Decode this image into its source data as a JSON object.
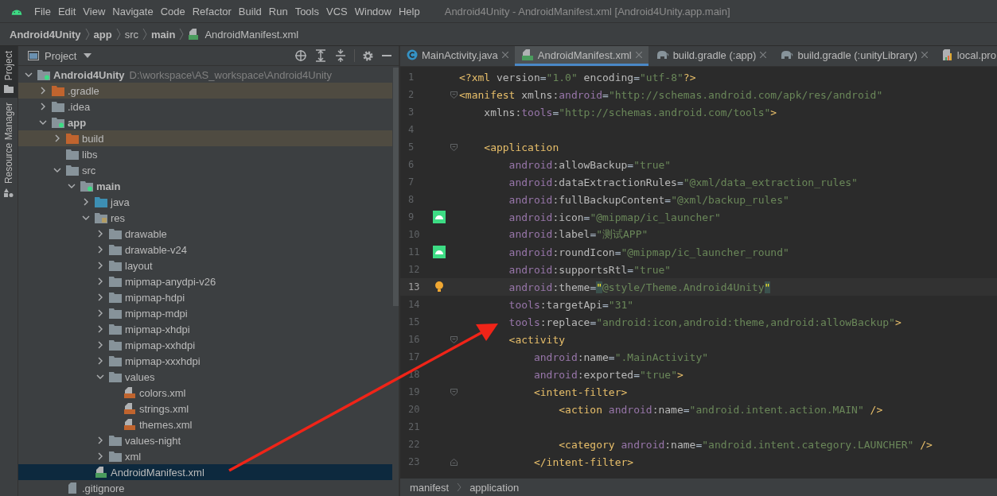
{
  "menu": {
    "items": [
      "File",
      "Edit",
      "View",
      "Navigate",
      "Code",
      "Refactor",
      "Build",
      "Run",
      "Tools",
      "VCS",
      "Window",
      "Help"
    ],
    "title": "Android4Unity - AndroidManifest.xml [Android4Unity.app.main]"
  },
  "navbar": [
    {
      "label": "Android4Unity",
      "kind": "module"
    },
    {
      "label": "app",
      "kind": "module"
    },
    {
      "label": "src",
      "kind": "folder"
    },
    {
      "label": "main",
      "kind": "module"
    },
    {
      "label": "AndroidManifest.xml",
      "kind": "manifest"
    }
  ],
  "side_tabs": [
    {
      "label": "Project",
      "selected": true,
      "kind": "project"
    },
    {
      "label": "Resource Manager",
      "selected": false,
      "kind": "resources"
    }
  ],
  "project_panel": {
    "title": "Project",
    "tree": [
      {
        "label": "Android4Unity",
        "detail": "D:\\workspace\\AS_workspace\\Android4Unity",
        "kind": "module",
        "bold": true,
        "excluded": false,
        "selected": false,
        "expanded": true,
        "children": [
          {
            "label": ".gradle",
            "kind": "excluded",
            "bold": false,
            "excluded": true,
            "selected": false,
            "expanded": false
          },
          {
            "label": ".idea",
            "kind": "folder",
            "bold": false,
            "excluded": false,
            "selected": false,
            "expanded": false
          },
          {
            "label": "app",
            "kind": "module",
            "bold": true,
            "excluded": false,
            "selected": false,
            "expanded": true,
            "children": [
              {
                "label": "build",
                "kind": "excluded",
                "bold": false,
                "excluded": true,
                "selected": false,
                "expanded": false
              },
              {
                "label": "libs",
                "kind": "folder",
                "bold": false,
                "excluded": false,
                "selected": false
              },
              {
                "label": "src",
                "kind": "folder",
                "bold": false,
                "excluded": false,
                "selected": false,
                "expanded": true,
                "children": [
                  {
                    "label": "main",
                    "kind": "module",
                    "bold": true,
                    "excluded": false,
                    "selected": false,
                    "expanded": true,
                    "children": [
                      {
                        "label": "java",
                        "kind": "source",
                        "bold": false,
                        "excluded": false,
                        "selected": false,
                        "expanded": false
                      },
                      {
                        "label": "res",
                        "kind": "res",
                        "bold": false,
                        "excluded": false,
                        "selected": false,
                        "expanded": true,
                        "children": [
                          {
                            "label": "drawable",
                            "kind": "folder",
                            "bold": false,
                            "excluded": false,
                            "selected": false,
                            "expanded": false
                          },
                          {
                            "label": "drawable-v24",
                            "kind": "folder",
                            "bold": false,
                            "excluded": false,
                            "selected": false,
                            "expanded": false
                          },
                          {
                            "label": "layout",
                            "kind": "folder",
                            "bold": false,
                            "excluded": false,
                            "selected": false,
                            "expanded": false
                          },
                          {
                            "label": "mipmap-anydpi-v26",
                            "kind": "folder",
                            "bold": false,
                            "excluded": false,
                            "selected": false,
                            "expanded": false
                          },
                          {
                            "label": "mipmap-hdpi",
                            "kind": "folder",
                            "bold": false,
                            "excluded": false,
                            "selected": false,
                            "expanded": false
                          },
                          {
                            "label": "mipmap-mdpi",
                            "kind": "folder",
                            "bold": false,
                            "excluded": false,
                            "selected": false,
                            "expanded": false
                          },
                          {
                            "label": "mipmap-xhdpi",
                            "kind": "folder",
                            "bold": false,
                            "excluded": false,
                            "selected": false,
                            "expanded": false
                          },
                          {
                            "label": "mipmap-xxhdpi",
                            "kind": "folder",
                            "bold": false,
                            "excluded": false,
                            "selected": false,
                            "expanded": false
                          },
                          {
                            "label": "mipmap-xxxhdpi",
                            "kind": "folder",
                            "bold": false,
                            "excluded": false,
                            "selected": false,
                            "expanded": false
                          },
                          {
                            "label": "values",
                            "kind": "folder",
                            "bold": false,
                            "excluded": false,
                            "selected": false,
                            "expanded": true,
                            "children": [
                              {
                                "label": "colors.xml",
                                "kind": "xml",
                                "bold": false,
                                "excluded": false,
                                "selected": false
                              },
                              {
                                "label": "strings.xml",
                                "kind": "xml",
                                "bold": false,
                                "excluded": false,
                                "selected": false
                              },
                              {
                                "label": "themes.xml",
                                "kind": "xml",
                                "bold": false,
                                "excluded": false,
                                "selected": false
                              }
                            ]
                          },
                          {
                            "label": "values-night",
                            "kind": "folder",
                            "bold": false,
                            "excluded": false,
                            "selected": false,
                            "expanded": false
                          },
                          {
                            "label": "xml",
                            "kind": "folder",
                            "bold": false,
                            "excluded": false,
                            "selected": false,
                            "expanded": false
                          }
                        ]
                      },
                      {
                        "label": "AndroidManifest.xml",
                        "kind": "manifest",
                        "bold": false,
                        "excluded": false,
                        "selected": true
                      }
                    ]
                  }
                ]
              },
              {
                "label": ".gitignore",
                "kind": "file",
                "bold": false,
                "excluded": false,
                "selected": false
              }
            ]
          }
        ]
      }
    ]
  },
  "editor": {
    "tabs": [
      {
        "label": "MainActivity.java",
        "kind": "class",
        "selected": false
      },
      {
        "label": "AndroidManifest.xml",
        "kind": "manifest",
        "selected": true
      },
      {
        "label": "build.gradle (:app)",
        "kind": "gradle",
        "selected": false
      },
      {
        "label": "build.gradle (:unityLibrary)",
        "kind": "gradle",
        "selected": false
      },
      {
        "label": "local.pro",
        "kind": "properties",
        "selected": false
      }
    ],
    "lines": [
      {
        "number": "1",
        "tokens": [
          {
            "kind": "tag",
            "text": "<?xml"
          },
          {
            "kind": "name",
            "text": " version"
          },
          {
            "kind": "plain",
            "text": "="
          },
          {
            "kind": "str",
            "text": "\"1.0\""
          },
          {
            "kind": "name",
            "text": " encoding"
          },
          {
            "kind": "plain",
            "text": "="
          },
          {
            "kind": "str",
            "text": "\"utf-8\""
          },
          {
            "kind": "tag",
            "text": "?>"
          }
        ]
      },
      {
        "number": "2",
        "fold_start": true,
        "tokens": [
          {
            "kind": "tag",
            "text": "<manifest"
          },
          {
            "kind": "name",
            "text": " xmlns:"
          },
          {
            "kind": "ns",
            "text": "android"
          },
          {
            "kind": "plain",
            "text": "="
          },
          {
            "kind": "str",
            "text": "\"http://schemas.android.com/apk/res/android\""
          }
        ]
      },
      {
        "number": "3",
        "tokens": [
          {
            "kind": "name",
            "text": "    xmlns:"
          },
          {
            "kind": "ns",
            "text": "tools"
          },
          {
            "kind": "plain",
            "text": "="
          },
          {
            "kind": "str",
            "text": "\"http://schemas.android.com/tools\""
          },
          {
            "kind": "tag",
            "text": ">"
          }
        ]
      },
      {
        "number": "4"
      },
      {
        "number": "5",
        "fold_start": true,
        "tokens": [
          {
            "kind": "tag",
            "text": "    <application"
          }
        ]
      },
      {
        "number": "6",
        "tokens": [
          {
            "kind": "ns",
            "text": "        android"
          },
          {
            "kind": "name",
            "text": ":allowBackup"
          },
          {
            "kind": "plain",
            "text": "="
          },
          {
            "kind": "str",
            "text": "\"true\""
          }
        ]
      },
      {
        "number": "7",
        "tokens": [
          {
            "kind": "ns",
            "text": "        android"
          },
          {
            "kind": "name",
            "text": ":dataExtractionRules"
          },
          {
            "kind": "plain",
            "text": "="
          },
          {
            "kind": "str",
            "text": "\"@xml/data_extraction_rules\""
          }
        ]
      },
      {
        "number": "8",
        "tokens": [
          {
            "kind": "ns",
            "text": "        android"
          },
          {
            "kind": "name",
            "text": ":fullBackupContent"
          },
          {
            "kind": "plain",
            "text": "="
          },
          {
            "kind": "str",
            "text": "\"@xml/backup_rules\""
          }
        ]
      },
      {
        "number": "9",
        "kind": "android",
        "tokens": [
          {
            "kind": "ns",
            "text": "        android"
          },
          {
            "kind": "name",
            "text": ":icon"
          },
          {
            "kind": "plain",
            "text": "="
          },
          {
            "kind": "str",
            "text": "\"@mipmap/ic_launcher\""
          }
        ]
      },
      {
        "number": "10",
        "tokens": [
          {
            "kind": "ns",
            "text": "        android"
          },
          {
            "kind": "name",
            "text": ":label"
          },
          {
            "kind": "plain",
            "text": "="
          },
          {
            "kind": "str",
            "text": "\"测试APP\""
          }
        ]
      },
      {
        "number": "11",
        "kind": "android",
        "tokens": [
          {
            "kind": "ns",
            "text": "        android"
          },
          {
            "kind": "name",
            "text": ":roundIcon"
          },
          {
            "kind": "plain",
            "text": "="
          },
          {
            "kind": "str",
            "text": "\"@mipmap/ic_launcher_round\""
          }
        ]
      },
      {
        "number": "12",
        "tokens": [
          {
            "kind": "ns",
            "text": "        android"
          },
          {
            "kind": "name",
            "text": ":supportsRtl"
          },
          {
            "kind": "plain",
            "text": "="
          },
          {
            "kind": "str",
            "text": "\"true\""
          }
        ]
      },
      {
        "number": "13",
        "current": true,
        "kind": "bulb",
        "tokens": [
          {
            "kind": "ns",
            "text": "        android"
          },
          {
            "kind": "name",
            "text": ":theme"
          },
          {
            "kind": "plain",
            "text": "="
          },
          {
            "kind": "match",
            "text": "\""
          },
          {
            "kind": "str",
            "text": "@style/Theme.Android4Unity"
          },
          {
            "kind": "match",
            "text": "\""
          }
        ]
      },
      {
        "number": "14",
        "tokens": [
          {
            "kind": "ns",
            "text": "        tools"
          },
          {
            "kind": "name",
            "text": ":targetApi"
          },
          {
            "kind": "plain",
            "text": "="
          },
          {
            "kind": "str",
            "text": "\"31\""
          }
        ]
      },
      {
        "number": "15",
        "tokens": [
          {
            "kind": "ns",
            "text": "        tools"
          },
          {
            "kind": "name",
            "text": ":replace"
          },
          {
            "kind": "plain",
            "text": "="
          },
          {
            "kind": "str",
            "text": "\"android:icon,android:theme,android:allowBackup\""
          },
          {
            "kind": "tag",
            "text": ">"
          }
        ]
      },
      {
        "number": "16",
        "fold_start": true,
        "tokens": [
          {
            "kind": "tag",
            "text": "        <activity"
          }
        ]
      },
      {
        "number": "17",
        "tokens": [
          {
            "kind": "ns",
            "text": "            android"
          },
          {
            "kind": "name",
            "text": ":name"
          },
          {
            "kind": "plain",
            "text": "="
          },
          {
            "kind": "str",
            "text": "\".MainActivity\""
          }
        ]
      },
      {
        "number": "18",
        "tokens": [
          {
            "kind": "ns",
            "text": "            android"
          },
          {
            "kind": "name",
            "text": ":exported"
          },
          {
            "kind": "plain",
            "text": "="
          },
          {
            "kind": "str",
            "text": "\"true\""
          },
          {
            "kind": "tag",
            "text": ">"
          }
        ]
      },
      {
        "number": "19",
        "fold_start": true,
        "tokens": [
          {
            "kind": "tag",
            "text": "            <intent-filter>"
          }
        ]
      },
      {
        "number": "20",
        "tokens": [
          {
            "kind": "tag",
            "text": "                <action"
          },
          {
            "kind": "ns",
            "text": " android"
          },
          {
            "kind": "name",
            "text": ":name"
          },
          {
            "kind": "plain",
            "text": "="
          },
          {
            "kind": "str",
            "text": "\"android.intent.action.MAIN\""
          },
          {
            "kind": "tag",
            "text": " />"
          }
        ]
      },
      {
        "number": "21"
      },
      {
        "number": "22",
        "tokens": [
          {
            "kind": "tag",
            "text": "                <category"
          },
          {
            "kind": "ns",
            "text": " android"
          },
          {
            "kind": "name",
            "text": ":name"
          },
          {
            "kind": "plain",
            "text": "="
          },
          {
            "kind": "str",
            "text": "\"android.intent.category.LAUNCHER\""
          },
          {
            "kind": "tag",
            "text": " />"
          }
        ]
      },
      {
        "number": "23",
        "fold_end": true,
        "tokens": [
          {
            "kind": "tag",
            "text": "            </intent-filter>"
          }
        ]
      }
    ],
    "breadcrumbs": [
      "manifest",
      "application"
    ]
  }
}
